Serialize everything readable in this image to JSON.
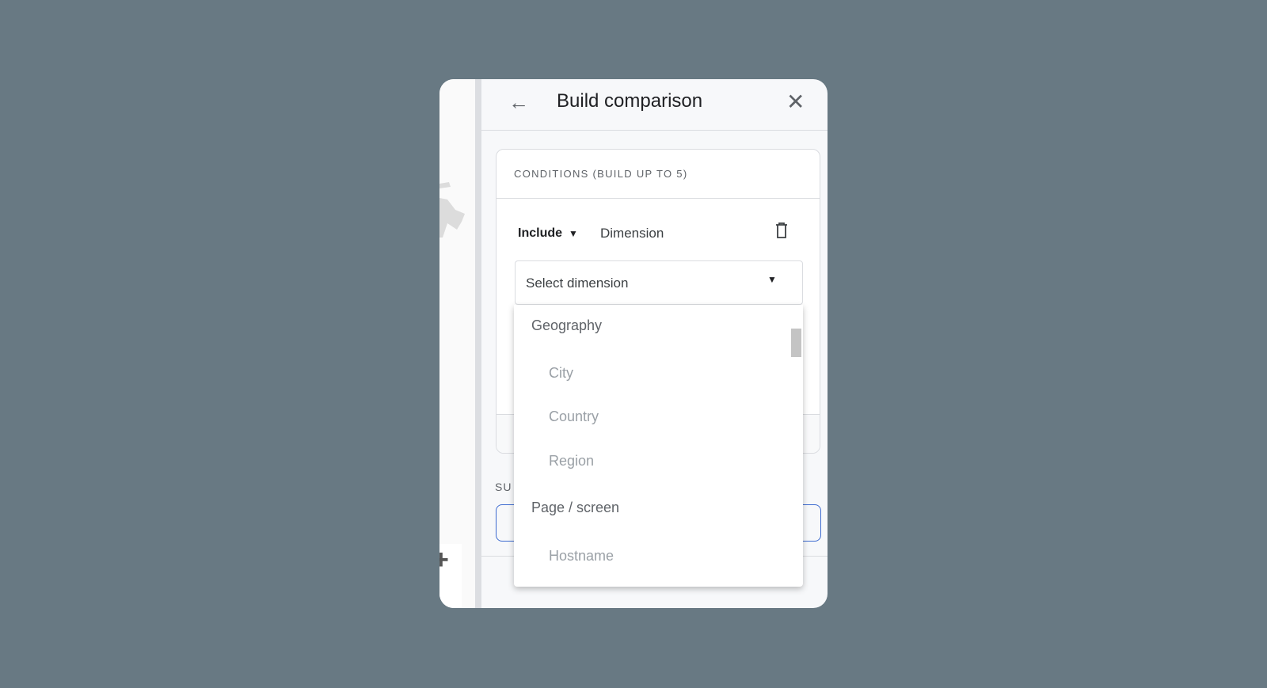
{
  "panel": {
    "title": "Build comparison",
    "back_icon": "arrow-left-icon",
    "close_icon": "close-icon"
  },
  "conditions": {
    "title": "CONDITIONS (BUILD UP TO 5)",
    "include_label": "Include",
    "dimension_label": "Dimension",
    "select": {
      "placeholder": "Select dimension"
    }
  },
  "summary_label_partial": "SU",
  "dropdown": {
    "groups": [
      {
        "label": "Geography",
        "items": [
          "City",
          "Country",
          "Region"
        ]
      },
      {
        "label": "Page / screen",
        "items": [
          "Hostname"
        ]
      }
    ]
  },
  "colors": {
    "background": "#687983",
    "accent": "#3d6bd0"
  }
}
